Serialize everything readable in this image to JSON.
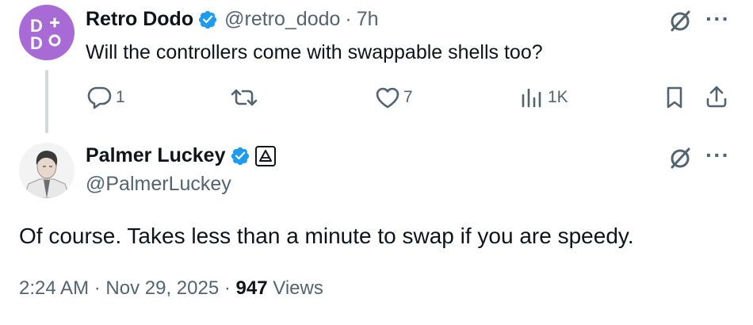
{
  "parent": {
    "author_name": "Retro Dodo",
    "handle": "@retro_dodo",
    "separator": "·",
    "time": "7h",
    "text": "Will the controllers come with swappable shells too?",
    "actions": {
      "reply_count": "1",
      "retweet_count": "",
      "like_count": "7",
      "views_count": "1K"
    }
  },
  "reply": {
    "author_name": "Palmer Luckey",
    "handle": "@PalmerLuckey",
    "text": "Of course.  Takes less than a minute to swap if you are speedy.",
    "time": "2:24 AM",
    "sep1": "·",
    "date": "Nov 29, 2025",
    "sep2": "·",
    "views_count": "947",
    "views_label": "Views"
  },
  "colors": {
    "verified": "#1d9bf0",
    "secondary_text": "#536471",
    "thread_line": "#cfd9de",
    "dodo_avatar": "#a86bd6"
  },
  "icons": [
    "verified-badge-icon",
    "grok-icon",
    "more-icon",
    "reply-icon",
    "retweet-icon",
    "like-icon",
    "views-icon",
    "bookmark-icon",
    "share-icon",
    "affiliate-badge-icon"
  ]
}
